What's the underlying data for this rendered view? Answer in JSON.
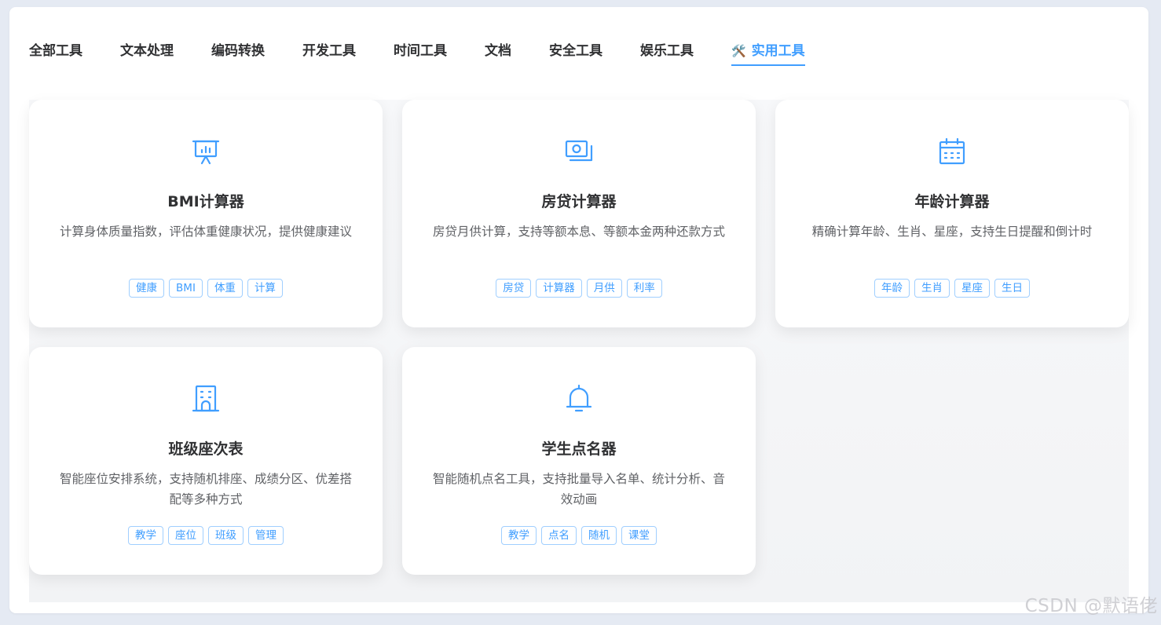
{
  "tabs": [
    {
      "label": "全部工具"
    },
    {
      "label": "文本处理"
    },
    {
      "label": "编码转换"
    },
    {
      "label": "开发工具"
    },
    {
      "label": "时间工具"
    },
    {
      "label": "文档"
    },
    {
      "label": "安全工具"
    },
    {
      "label": "娱乐工具"
    },
    {
      "label": "实用工具",
      "icon": "🛠️",
      "icon_name": "tools-icon",
      "active": true
    }
  ],
  "colors": {
    "accent": "#409eff",
    "tag_border": "#a0cfff",
    "text_primary": "#303133",
    "text_secondary": "#606266"
  },
  "cards": [
    {
      "icon": "presentation-chart-icon",
      "title": "BMI计算器",
      "desc": "计算身体质量指数，评估体重健康状况，提供健康建议",
      "tags": [
        "健康",
        "BMI",
        "体重",
        "计算"
      ]
    },
    {
      "icon": "money-bill-icon",
      "title": "房贷计算器",
      "desc": "房贷月供计算，支持等额本息、等额本金两种还款方式",
      "tags": [
        "房贷",
        "计算器",
        "月供",
        "利率"
      ]
    },
    {
      "icon": "calendar-icon",
      "title": "年龄计算器",
      "desc": "精确计算年龄、生肖、星座，支持生日提醒和倒计时",
      "tags": [
        "年龄",
        "生肖",
        "星座",
        "生日"
      ]
    },
    {
      "icon": "building-icon",
      "title": "班级座次表",
      "desc": "智能座位安排系统，支持随机排座、成绩分区、优差搭配等多种方式",
      "tags": [
        "教学",
        "座位",
        "班级",
        "管理"
      ]
    },
    {
      "icon": "bell-icon",
      "title": "学生点名器",
      "desc": "智能随机点名工具，支持批量导入名单、统计分析、音效动画",
      "tags": [
        "教学",
        "点名",
        "随机",
        "课堂"
      ]
    }
  ],
  "watermark": "CSDN @默语佬"
}
